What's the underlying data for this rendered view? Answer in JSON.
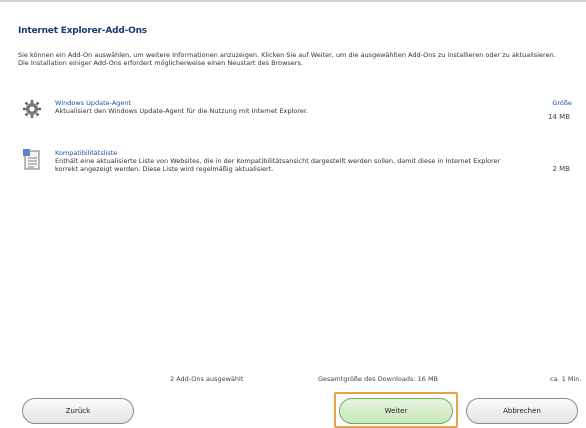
{
  "heading": "Internet Explorer-Add-Ons",
  "description": "Sie können ein Add-On auswählen, um weitere Informationen anzuzeigen. Klicken Sie auf Weiter, um die ausgewählten Add-Ons zu installieren oder zu aktualisieren. Die Installation einiger Add-Ons erfordert möglicherweise einen Neustart des Browsers.",
  "size_column_label": "Größe",
  "items": [
    {
      "name": "Windows Update-Agent",
      "info": "Aktualisiert den Windows Update-Agent für die Nutzung mit Internet Explorer.",
      "size": "14 MB",
      "icon": "gear-icon"
    },
    {
      "name": "Kompatibilitätsliste",
      "info": "Enthält eine aktualisierte Liste von Websites, die in der Kompatibilitätsansicht dargestellt werden sollen, damit diese in Internet Explorer korrekt angezeigt werden. Diese Liste wird regelmäßig aktualisiert.",
      "size": "2 MB",
      "icon": "document-list-icon"
    }
  ],
  "summary": {
    "selected": "2 Add-Ons ausgewählt",
    "download": "Gesamtgröße des Downloads: 16 MB",
    "time": "ca. 1 Min."
  },
  "buttons": {
    "back": "Zurück",
    "next": "Weiter",
    "cancel": "Abbrechen"
  }
}
